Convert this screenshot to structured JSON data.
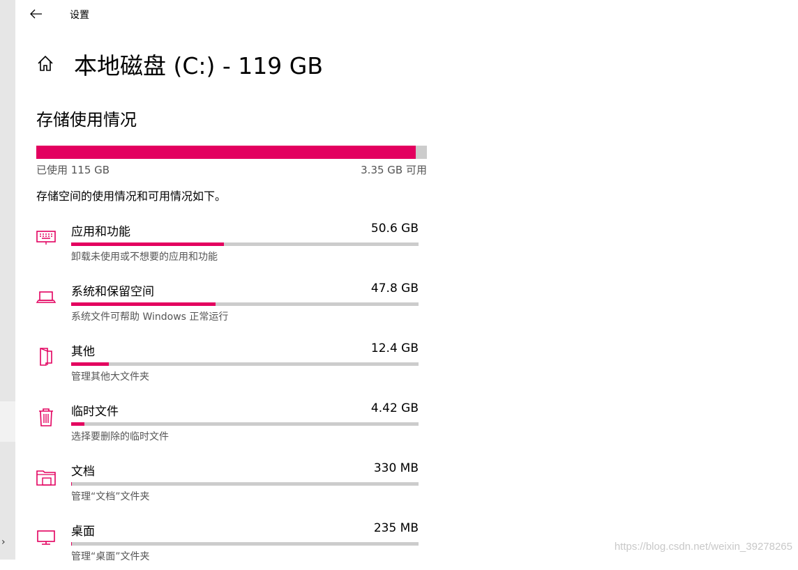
{
  "window": {
    "title": "设置"
  },
  "header": {
    "title": "本地磁盘 (C:) - 119 GB"
  },
  "storage": {
    "section_title": "存储使用情况",
    "used_label": "已使用 115 GB",
    "free_label": "3.35 GB 可用",
    "used_fraction": 0.972,
    "description": "存储空间的使用情况和可用情况如下。"
  },
  "categories": [
    {
      "name": "应用和功能",
      "size": "50.6 GB",
      "subtitle": "卸载未使用或不想要的应用和功能",
      "icon": "apps-icon",
      "fraction": 0.44
    },
    {
      "name": "系统和保留空间",
      "size": "47.8 GB",
      "subtitle": "系统文件可帮助 Windows 正常运行",
      "icon": "laptop-icon",
      "fraction": 0.415
    },
    {
      "name": "其他",
      "size": "12.4 GB",
      "subtitle": "管理其他大文件夹",
      "icon": "folder-other-icon",
      "fraction": 0.108
    },
    {
      "name": "临时文件",
      "size": "4.42 GB",
      "subtitle": "选择要删除的临时文件",
      "icon": "trash-icon",
      "fraction": 0.038
    },
    {
      "name": "文档",
      "size": "330 MB",
      "subtitle": "管理“文档”文件夹",
      "icon": "documents-icon",
      "fraction": 0.003
    },
    {
      "name": "桌面",
      "size": "235 MB",
      "subtitle": "管理“桌面”文件夹",
      "icon": "desktop-icon",
      "fraction": 0.002
    }
  ],
  "watermark": "https://blog.csdn.net/weixin_39278265",
  "colors": {
    "accent": "#e3005f",
    "bar_track": "#cccccc",
    "icon": "#e3005f"
  }
}
